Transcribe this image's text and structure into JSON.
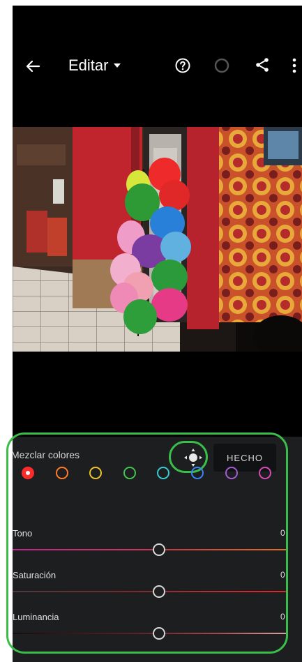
{
  "topbar": {
    "title": "Editar",
    "icons": {
      "back": "arrow-left-icon",
      "title_menu": "caret-down-icon",
      "help": "help-circle-icon",
      "progress": "progress-ring-icon",
      "share": "share-icon",
      "more": "more-vertical-icon"
    }
  },
  "panel": {
    "title": "Mezclar colores",
    "done_label": "HECHO",
    "target_icon": "targeted-adjustment-icon",
    "swatches": [
      {
        "name": "red",
        "color": "#ff2b2b",
        "selected": true
      },
      {
        "name": "orange",
        "color": "#ff7a2a",
        "selected": false
      },
      {
        "name": "yellow",
        "color": "#f0c22a",
        "selected": false
      },
      {
        "name": "green",
        "color": "#44c252",
        "selected": false
      },
      {
        "name": "aqua",
        "color": "#38cbd0",
        "selected": false
      },
      {
        "name": "blue",
        "color": "#3c82f5",
        "selected": false
      },
      {
        "name": "purple",
        "color": "#a55bd1",
        "selected": false
      },
      {
        "name": "magenta",
        "color": "#d64bb6",
        "selected": false
      }
    ],
    "sliders": [
      {
        "label": "Tono",
        "value": "0",
        "level": 0.5
      },
      {
        "label": "Saturación",
        "value": "0",
        "level": 0.5
      },
      {
        "label": "Luminancia",
        "value": "0",
        "level": 0.5
      }
    ]
  },
  "colors": {
    "highlight": "#3bbd4a",
    "panel_bg": "#1d1e20",
    "screen_bg": "#000000"
  }
}
